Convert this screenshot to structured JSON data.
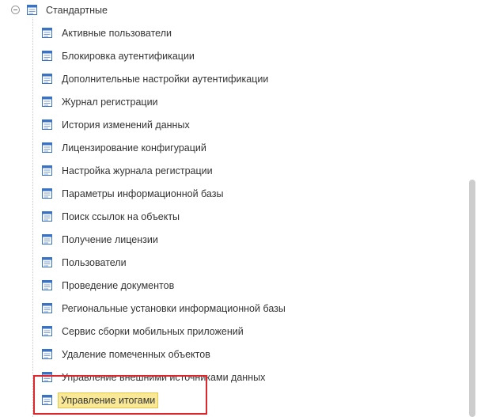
{
  "tree": {
    "root": {
      "label": "Стандартные",
      "expanded": true,
      "icon": "doc-list-icon",
      "toggle_icon": "collapse-minus-icon"
    },
    "items": [
      {
        "label": "Активные пользователи",
        "icon": "doc-list-icon"
      },
      {
        "label": "Блокировка аутентификации",
        "icon": "doc-list-icon"
      },
      {
        "label": "Дополнительные настройки аутентификации",
        "icon": "doc-list-icon"
      },
      {
        "label": "Журнал регистрации",
        "icon": "doc-list-icon"
      },
      {
        "label": "История изменений данных",
        "icon": "doc-list-icon"
      },
      {
        "label": "Лицензирование конфигураций",
        "icon": "doc-list-icon"
      },
      {
        "label": "Настройка журнала регистрации",
        "icon": "doc-list-icon"
      },
      {
        "label": "Параметры информационной базы",
        "icon": "doc-list-icon"
      },
      {
        "label": "Поиск ссылок на объекты",
        "icon": "doc-list-icon"
      },
      {
        "label": "Получение лицензии",
        "icon": "doc-list-icon"
      },
      {
        "label": "Пользователи",
        "icon": "doc-list-icon"
      },
      {
        "label": "Проведение документов",
        "icon": "doc-list-icon"
      },
      {
        "label": "Региональные установки информационной базы",
        "icon": "doc-list-icon"
      },
      {
        "label": "Сервис сборки мобильных приложений",
        "icon": "doc-list-icon"
      },
      {
        "label": "Удаление помеченных объектов",
        "icon": "doc-list-icon"
      },
      {
        "label": "Управление внешними источниками данных",
        "icon": "doc-list-icon"
      },
      {
        "label": "Управление итогами",
        "icon": "doc-list-icon",
        "selected": true
      }
    ]
  },
  "colors": {
    "selection_fill": "#f9e896",
    "selection_border": "#e2c94d",
    "annotation_box": "#e0262d",
    "icon_blue": "#3a73c4",
    "text": "#333333"
  }
}
